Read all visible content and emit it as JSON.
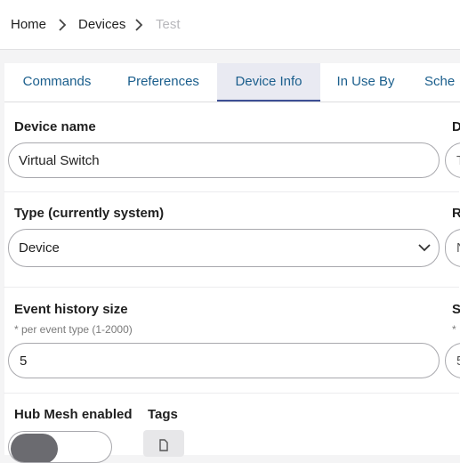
{
  "breadcrumb": {
    "home": "Home",
    "devices": "Devices",
    "current": "Test"
  },
  "tabs": [
    "Commands",
    "Preferences",
    "Device Info",
    "In Use By",
    "Sche"
  ],
  "active_tab": "Device Info",
  "fields": {
    "device_name": {
      "label": "Device name",
      "value": "Virtual Switch"
    },
    "type": {
      "label": "Type (currently system)",
      "value": "Device"
    },
    "event_history": {
      "label": "Event history size",
      "hint": "* per event type (1-2000)",
      "value": "5"
    },
    "hub_mesh": {
      "label": "Hub Mesh enabled",
      "enabled": true
    },
    "tags": {
      "label": "Tags"
    }
  },
  "right_column": {
    "label1": "D",
    "label2": "R",
    "label3": "S",
    "hint3": "*",
    "val1": "T",
    "val2": "N",
    "val3": "5"
  },
  "colors": {
    "accent": "#1a5e8c",
    "active_tab_bg": "#e9eaf2",
    "active_tab_border": "#3d4f94"
  }
}
